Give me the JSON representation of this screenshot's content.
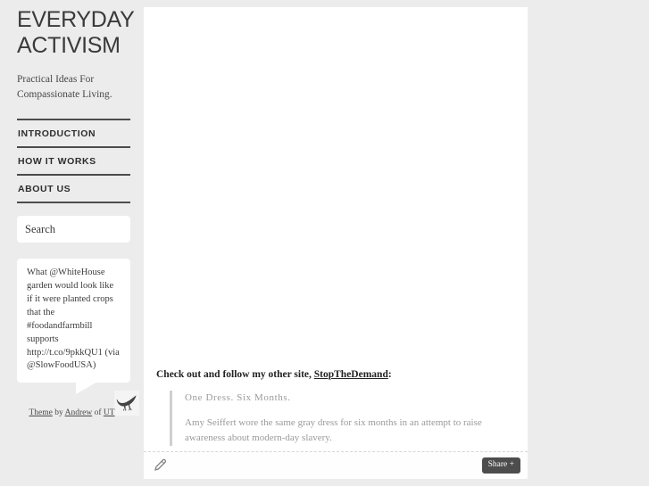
{
  "site": {
    "title": "EVERYDAY ACTIVISM",
    "tagline": "Practical Ideas For Compassionate Living."
  },
  "nav": {
    "items": [
      {
        "label": "INTRODUCTION"
      },
      {
        "label": "HOW IT WORKS"
      },
      {
        "label": "ABOUT US"
      }
    ]
  },
  "search": {
    "placeholder": "Search",
    "value": ""
  },
  "tweet": {
    "text": "What @WhiteHouse garden would look like if it were planted crops that the #foodandfarmbill supports http://t.co/9pkkQU1 (via @SlowFoodUSA)",
    "bird_icon": "twitter-bird-icon"
  },
  "credit": {
    "theme_label": "Theme",
    "by_label": " by ",
    "author_label": "Andrew",
    "of_label": " of ",
    "org_label": "UT"
  },
  "post": {
    "intro_before_link": "Check out and follow my other site, ",
    "intro_link": "StopTheDemand",
    "intro_after_link": ":",
    "quote_title": "One Dress. Six Months.",
    "quote_body": "Amy Seiffert wore the same gray dress for six months in an attempt to raise awareness about modern-day slavery."
  },
  "toolbar": {
    "edit_icon": "pencil-icon",
    "share_label": "Share +"
  },
  "colors": {
    "page_background": "#ececec",
    "panel_background": "#ffffff",
    "nav_rule": "#4c4c4c",
    "share_button": "#4d4d4d",
    "quote_text": "#9a9a9a",
    "quote_bar": "#cfcfcf"
  }
}
